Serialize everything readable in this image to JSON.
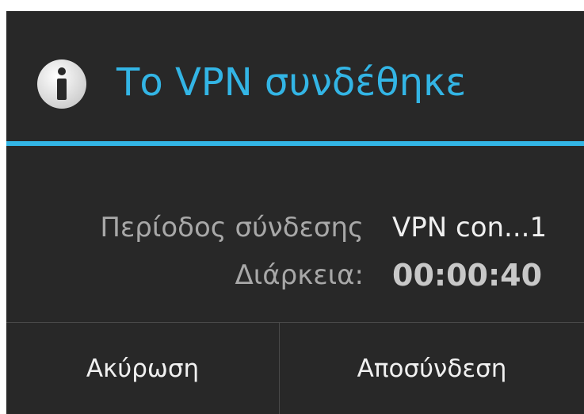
{
  "dialog": {
    "title": "Το VPN συνδέθηκε",
    "icon": "info-icon",
    "session_label": "Περίοδος σύνδεσης",
    "session_value": "VPN con...1",
    "duration_label": "Διάρκεια:",
    "duration_value": "00:00:40",
    "cancel_label": "Ακύρωση",
    "disconnect_label": "Αποσύνδεση"
  },
  "colors": {
    "background": "#282828",
    "accent": "#33b5e5",
    "title": "#33b5e5",
    "label": "#a8a8a8",
    "value": "#f0f0f0",
    "duration_value": "#c8c8c8",
    "button_text": "#f0f0f0"
  }
}
